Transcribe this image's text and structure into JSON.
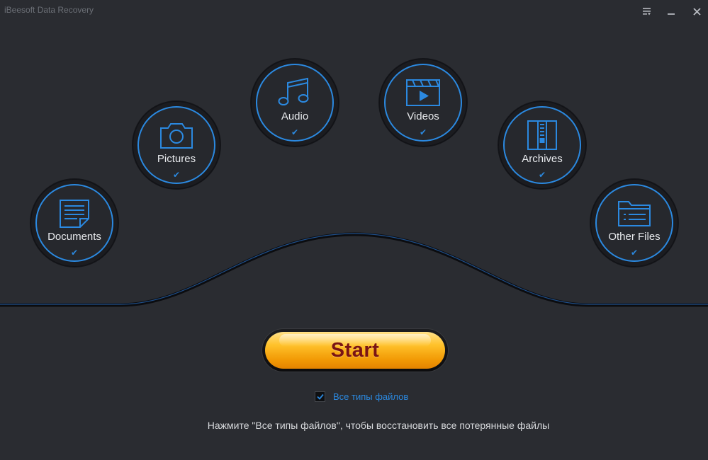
{
  "window": {
    "title": "iBeesoft Data Recovery",
    "controls": [
      {
        "name": "menu",
        "icon": "menu-icon"
      },
      {
        "name": "minimize",
        "icon": "minimize-icon"
      },
      {
        "name": "close",
        "icon": "close-icon"
      }
    ]
  },
  "categories": [
    {
      "label": "Documents",
      "icon": "document-icon",
      "checked": true
    },
    {
      "label": "Pictures",
      "icon": "camera-icon",
      "checked": true
    },
    {
      "label": "Audio",
      "icon": "music-note-icon",
      "checked": true
    },
    {
      "label": "Videos",
      "icon": "clapperboard-icon",
      "checked": true
    },
    {
      "label": "Archives",
      "icon": "zip-archive-icon",
      "checked": true
    },
    {
      "label": "Other Files",
      "icon": "folder-icon",
      "checked": true
    }
  ],
  "start_button": {
    "label": "Start"
  },
  "all_types": {
    "label": "Все типы файлов",
    "checked": true
  },
  "hint": "Нажмите \"Все типы файлов\", чтобы восстановить все потерянные файлы",
  "colors": {
    "background": "#2a2c31",
    "accent": "#2b89e0",
    "start_gold": "#ffc22b",
    "start_text": "#7a1414"
  }
}
